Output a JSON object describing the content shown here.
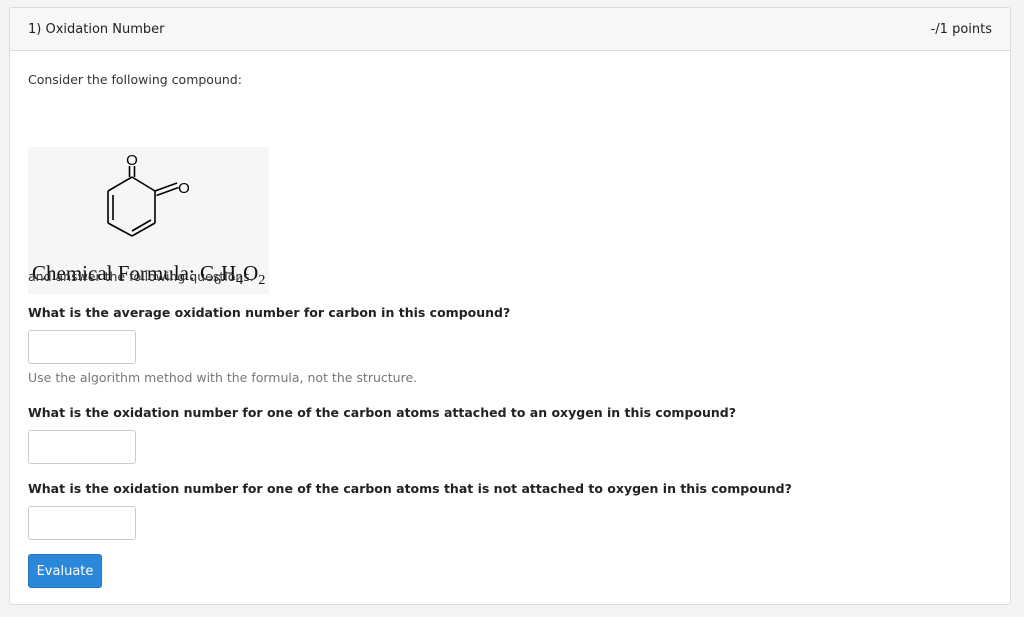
{
  "header": {
    "title": "1) Oxidation Number",
    "points": "-/1 points"
  },
  "intro": "Consider the following compound:",
  "compound": {
    "image_icon": "benzoquinone-structure",
    "formula_label": "Chemical Formula: ",
    "formula_c": "C",
    "formula_c_sub": "6",
    "formula_h": "H",
    "formula_h_sub": "4",
    "formula_o": "O",
    "formula_o_sub": "2"
  },
  "follow_up": "and answer the following questions.",
  "questions": [
    {
      "text": "What is the average oxidation number for carbon in this compound?",
      "value": "",
      "hint": "Use the algorithm method with the formula, not the structure."
    },
    {
      "text": "What is the oxidation number for one of the carbon atoms attached to an oxygen in this compound?",
      "value": ""
    },
    {
      "text": "What is the oxidation number for one of the carbon atoms that is not attached to oxygen in this compound?",
      "value": ""
    }
  ],
  "evaluate_label": "Evaluate",
  "colors": {
    "button": "#2b87d9",
    "hint": "#777777"
  }
}
